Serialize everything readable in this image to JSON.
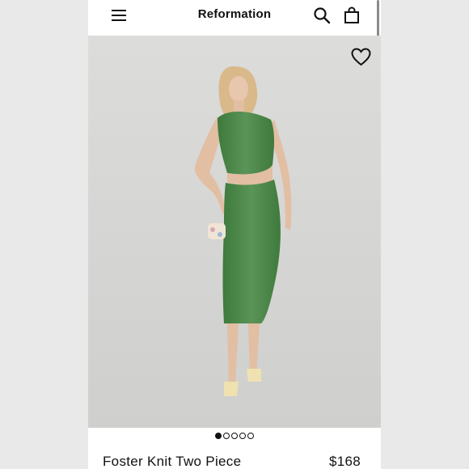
{
  "header": {
    "brand": "Reformation",
    "menu_icon": "hamburger-menu-icon",
    "search_icon": "search-icon",
    "bag_icon": "shopping-bag-icon"
  },
  "product": {
    "name": "Foster Knit Two Piece",
    "price": "$168",
    "image_label": "model wearing green knit sleeveless top and midi skirt with cream sandals"
  },
  "gallery": {
    "total_images": 5,
    "active_index": 0,
    "favorite_icon": "heart-icon"
  },
  "colors": {
    "outfit_green": "#4f8a4c",
    "background": "#d6d6d4",
    "page_border": "#e9e9ea",
    "text": "#111111"
  }
}
